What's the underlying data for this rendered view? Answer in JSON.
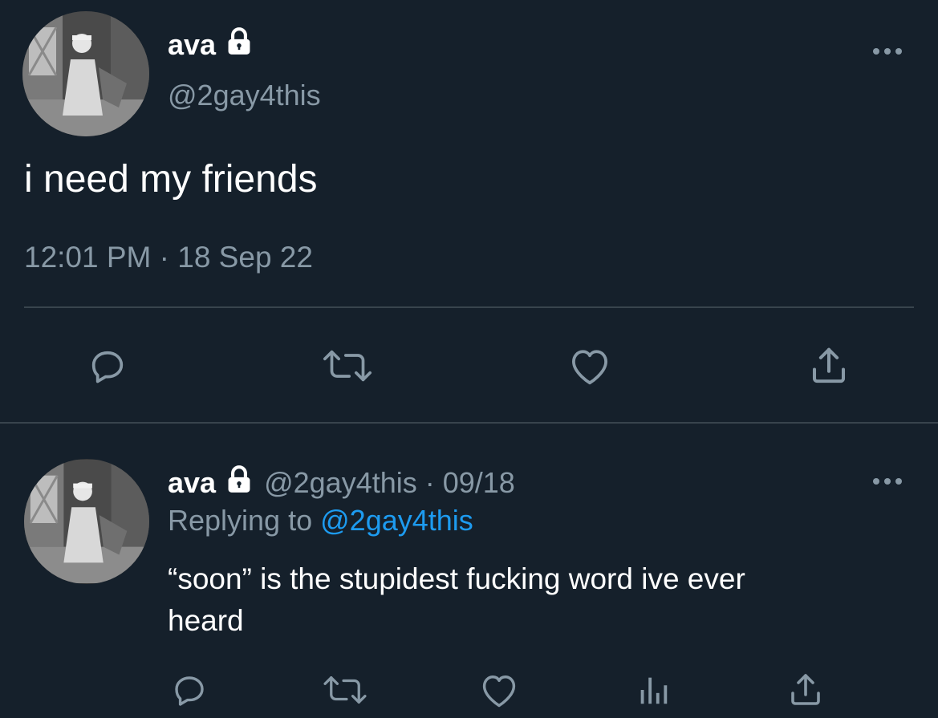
{
  "main_tweet": {
    "name": "ava",
    "handle": "@2gay4this",
    "text": "i need my friends",
    "timestamp": "12:01 PM · 18 Sep 22",
    "icons": {
      "locked": "lock-icon",
      "more": "more-options-icon",
      "reply": "reply-icon",
      "retweet": "retweet-icon",
      "like": "like-icon",
      "share": "share-icon"
    }
  },
  "reply_tweet": {
    "name": "ava",
    "handle_date": "@2gay4this · 09/18",
    "replying_prefix": "Replying to",
    "replying_handle": "@2gay4this",
    "text_line1": "“soon” is the stupidest fucking word ive ever",
    "text_line2": "heard",
    "icons": {
      "locked": "lock-icon",
      "more": "more-options-icon",
      "reply": "reply-icon",
      "retweet": "retweet-icon",
      "like": "like-icon",
      "analytics": "analytics-icon",
      "share": "share-icon"
    }
  },
  "colors": {
    "background": "#15202b",
    "muted": "#8899a6",
    "link": "#1d9bf0",
    "divider": "#38444d"
  }
}
